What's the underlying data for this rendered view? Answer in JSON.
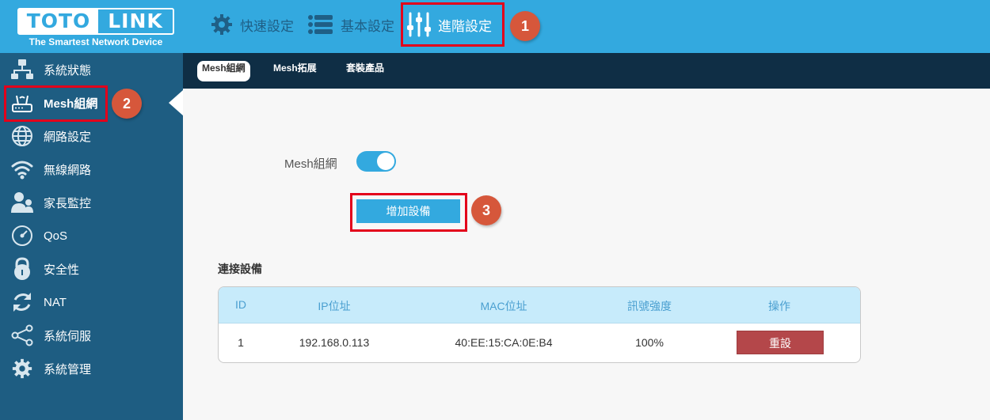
{
  "header": {
    "logo_left": "TOTO",
    "logo_right": "LINK",
    "logo_tagline": "The Smartest Network Device",
    "nav": [
      {
        "label": "快速設定",
        "icon": "gear-icon"
      },
      {
        "label": "基本設定",
        "icon": "list-icon"
      },
      {
        "label": "進階設定",
        "icon": "sliders-icon",
        "active": true
      }
    ]
  },
  "annotations": [
    "1",
    "2",
    "3"
  ],
  "sidebar": {
    "items": [
      {
        "label": "系統狀態",
        "icon": "network-icon"
      },
      {
        "label": "Mesh組網",
        "icon": "router-icon",
        "active": true
      },
      {
        "label": "網路設定",
        "icon": "globe-icon"
      },
      {
        "label": "無線網路",
        "icon": "wifi-icon"
      },
      {
        "label": "家長監控",
        "icon": "parental-icon"
      },
      {
        "label": "QoS",
        "icon": "gauge-icon"
      },
      {
        "label": "安全性",
        "icon": "lock-icon"
      },
      {
        "label": "NAT",
        "icon": "refresh-icon"
      },
      {
        "label": "系統伺服",
        "icon": "share-icon"
      },
      {
        "label": "系統管理",
        "icon": "gear-icon"
      }
    ]
  },
  "subnav": {
    "tabs": [
      {
        "label": "Mesh組網",
        "active": true
      },
      {
        "label": "Mesh拓展"
      },
      {
        "label": "套裝產品"
      }
    ]
  },
  "main": {
    "mesh_label": "Mesh組網",
    "mesh_enabled": true,
    "add_button": "增加設備",
    "section_title": "連接設備",
    "table": {
      "headers": [
        "ID",
        "IP位址",
        "MAC位址",
        "訊號強度",
        "操作"
      ],
      "rows": [
        {
          "id": "1",
          "ip": "192.168.0.113",
          "mac": "40:EE:15:CA:0E:B4",
          "signal": "100%",
          "action": "重設"
        }
      ]
    }
  },
  "colors": {
    "header_bg": "#33a9df",
    "sidebar_bg": "#1e5d82",
    "subnav_bg": "#0f2e45",
    "highlight": "#e3001b",
    "badge": "#d6573b",
    "reset": "#b4474a"
  }
}
